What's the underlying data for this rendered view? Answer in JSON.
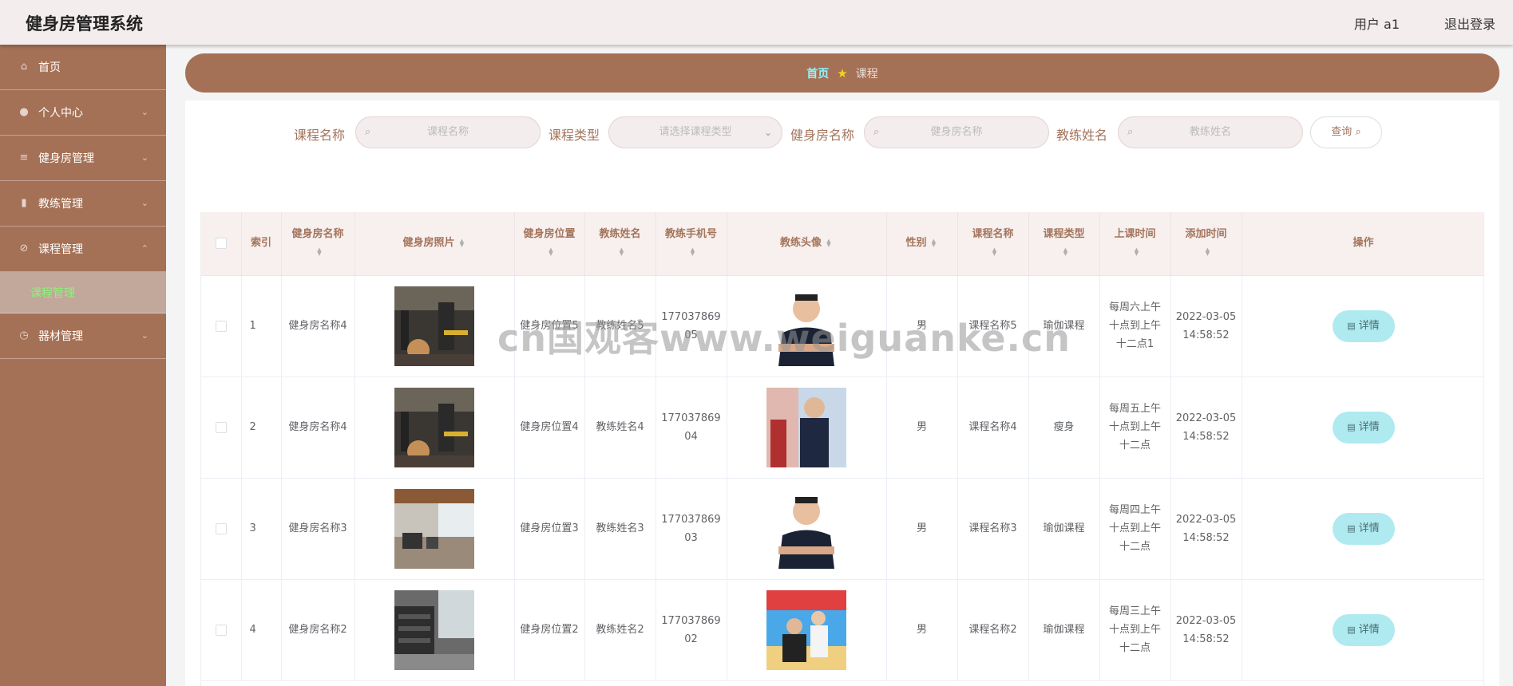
{
  "app": {
    "title": "健身房管理系统"
  },
  "header": {
    "user_label": "用户 a1",
    "logout_label": "退出登录"
  },
  "sidebar": {
    "items": [
      {
        "label": "首页",
        "icon": "home-icon"
      },
      {
        "label": "个人中心",
        "icon": "user-icon"
      },
      {
        "label": "健身房管理",
        "icon": "list-icon"
      },
      {
        "label": "教练管理",
        "icon": "bar-chart-icon"
      },
      {
        "label": "课程管理",
        "icon": "compass-icon"
      },
      {
        "label": "器材管理",
        "icon": "clock-icon"
      }
    ],
    "active_sub": "课程管理"
  },
  "breadcrumb": {
    "home": "首页",
    "current": "课程"
  },
  "search": {
    "course_name_label": "课程名称",
    "course_name_placeholder": "课程名称",
    "course_type_label": "课程类型",
    "course_type_placeholder": "请选择课程类型",
    "gym_name_label": "健身房名称",
    "gym_name_placeholder": "健身房名称",
    "coach_name_label": "教练姓名",
    "coach_name_placeholder": "教练姓名",
    "query_label": "查询"
  },
  "table": {
    "headers": {
      "index": "索引",
      "gym_name": "健身房名称",
      "gym_photo": "健身房照片",
      "gym_location": "健身房位置",
      "coach_name": "教练姓名",
      "coach_phone": "教练手机号",
      "coach_avatar": "教练头像",
      "gender": "性别",
      "course_name": "课程名称",
      "course_type": "课程类型",
      "class_time": "上课时间",
      "add_time": "添加时间",
      "actions": "操作"
    },
    "rows": [
      {
        "index": "1",
        "gym_name": "健身房名称4",
        "gym_location": "健身房位置5",
        "coach_name": "教练姓名5",
        "coach_phone": "17703786905",
        "gender": "男",
        "course_name": "课程名称5",
        "course_type": "瑜伽课程",
        "class_time": "每周六上午十点到上午十二点1",
        "add_time": "2022-03-05 14:58:52",
        "detail": "详情"
      },
      {
        "index": "2",
        "gym_name": "健身房名称4",
        "gym_location": "健身房位置4",
        "coach_name": "教练姓名4",
        "coach_phone": "17703786904",
        "gender": "男",
        "course_name": "课程名称4",
        "course_type": "瘦身",
        "class_time": "每周五上午十点到上午十二点",
        "add_time": "2022-03-05 14:58:52",
        "detail": "详情"
      },
      {
        "index": "3",
        "gym_name": "健身房名称3",
        "gym_location": "健身房位置3",
        "coach_name": "教练姓名3",
        "coach_phone": "17703786903",
        "gender": "男",
        "course_name": "课程名称3",
        "course_type": "瑜伽课程",
        "class_time": "每周四上午十点到上午十二点",
        "add_time": "2022-03-05 14:58:52",
        "detail": "详情"
      },
      {
        "index": "4",
        "gym_name": "健身房名称2",
        "gym_location": "健身房位置2",
        "coach_name": "教练姓名2",
        "coach_phone": "17703786902",
        "gender": "男",
        "course_name": "课程名称2",
        "course_type": "瑜伽课程",
        "class_time": "每周三上午十点到上午十二点",
        "add_time": "2022-03-05 14:58:52",
        "detail": "详情"
      }
    ]
  },
  "watermark": "cn国观客www.weiguanke.cn"
}
